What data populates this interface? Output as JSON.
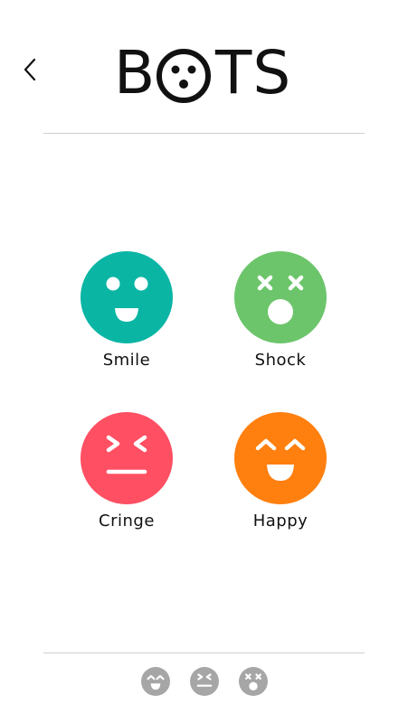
{
  "header": {
    "back_icon": "chevron-left-icon",
    "logo": {
      "part1": "B",
      "part2": "TS",
      "logo_icon": "shocked-face-o"
    }
  },
  "bots": [
    {
      "id": "smile",
      "label": "Smile",
      "color": "#0ab5a4",
      "icon": "smile-face-icon"
    },
    {
      "id": "shock",
      "label": "Shock",
      "color": "#6cc56b",
      "icon": "shock-face-icon"
    },
    {
      "id": "cringe",
      "label": "Cringe",
      "color": "#ff4f63",
      "icon": "cringe-face-icon"
    },
    {
      "id": "happy",
      "label": "Happy",
      "color": "#ff7f0f",
      "icon": "happy-face-icon"
    }
  ],
  "bottom_nav": {
    "color": "#a6a6a6",
    "icons": [
      "happy-face-icon",
      "cringe-face-icon",
      "shock-face-icon"
    ]
  }
}
